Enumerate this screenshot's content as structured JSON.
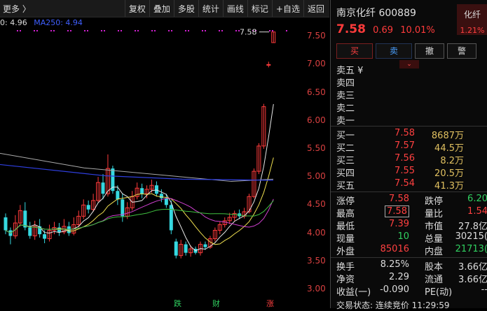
{
  "toolbar": {
    "more": "更多 〉",
    "tabs": [
      "复权",
      "叠加",
      "多股",
      "统计",
      "画线",
      "标记",
      "+自选",
      "返回"
    ]
  },
  "ma_legend": {
    "a": "0: 4.96",
    "b": "MA250: 4.94"
  },
  "price_axis": {
    "ticks": [
      "7.50",
      "7.00",
      "6.50",
      "6.00",
      "5.50",
      "5.00",
      "4.50",
      "4.00",
      "3.50",
      "3.00"
    ],
    "high_marker": "7.58"
  },
  "chart_markers": [
    "跌",
    "财",
    "涨"
  ],
  "chart_data": {
    "type": "candlestick",
    "ylim": [
      2.8,
      7.85
    ],
    "candles": [
      {
        "o": 4.28,
        "c": 4.05,
        "h": 4.35,
        "l": 3.98
      },
      {
        "o": 4.05,
        "c": 3.95,
        "h": 4.1,
        "l": 3.8
      },
      {
        "o": 3.95,
        "c": 4.18,
        "h": 4.32,
        "l": 3.9
      },
      {
        "o": 4.18,
        "c": 4.4,
        "h": 4.5,
        "l": 4.12
      },
      {
        "o": 4.4,
        "c": 4.1,
        "h": 4.55,
        "l": 4.05
      },
      {
        "o": 4.1,
        "c": 3.95,
        "h": 4.2,
        "l": 3.9
      },
      {
        "o": 3.95,
        "c": 4.12,
        "h": 4.22,
        "l": 3.88
      },
      {
        "o": 4.12,
        "c": 3.98,
        "h": 4.25,
        "l": 3.92
      },
      {
        "o": 3.98,
        "c": 3.9,
        "h": 4.05,
        "l": 3.82
      },
      {
        "o": 3.9,
        "c": 4.05,
        "h": 4.15,
        "l": 3.85
      },
      {
        "o": 4.05,
        "c": 4.1,
        "h": 4.2,
        "l": 3.98
      },
      {
        "o": 4.1,
        "c": 4.02,
        "h": 4.18,
        "l": 3.95
      },
      {
        "o": 4.02,
        "c": 4.12,
        "h": 4.25,
        "l": 3.98
      },
      {
        "o": 4.12,
        "c": 4.0,
        "h": 4.2,
        "l": 3.95
      },
      {
        "o": 4.0,
        "c": 4.15,
        "h": 4.28,
        "l": 3.96
      },
      {
        "o": 4.15,
        "c": 4.3,
        "h": 4.4,
        "l": 4.1
      },
      {
        "o": 4.3,
        "c": 4.5,
        "h": 4.6,
        "l": 4.25
      },
      {
        "o": 4.5,
        "c": 4.42,
        "h": 4.58,
        "l": 4.35
      },
      {
        "o": 4.42,
        "c": 4.58,
        "h": 4.7,
        "l": 4.38
      },
      {
        "o": 4.58,
        "c": 4.9,
        "h": 5.0,
        "l": 4.55
      },
      {
        "o": 4.9,
        "c": 4.7,
        "h": 5.05,
        "l": 4.6
      },
      {
        "o": 4.7,
        "c": 5.15,
        "h": 5.4,
        "l": 4.65
      },
      {
        "o": 5.15,
        "c": 4.75,
        "h": 5.2,
        "l": 4.7
      },
      {
        "o": 4.75,
        "c": 4.6,
        "h": 4.85,
        "l": 4.5
      },
      {
        "o": 4.6,
        "c": 4.3,
        "h": 4.7,
        "l": 4.2
      },
      {
        "o": 4.3,
        "c": 4.45,
        "h": 4.55,
        "l": 4.25
      },
      {
        "o": 4.45,
        "c": 4.65,
        "h": 4.75,
        "l": 4.4
      },
      {
        "o": 4.65,
        "c": 4.8,
        "h": 4.9,
        "l": 4.6
      },
      {
        "o": 4.8,
        "c": 4.7,
        "h": 4.88,
        "l": 4.62
      },
      {
        "o": 4.7,
        "c": 4.78,
        "h": 4.85,
        "l": 4.62
      },
      {
        "o": 4.78,
        "c": 4.85,
        "h": 4.95,
        "l": 4.72
      },
      {
        "o": 4.85,
        "c": 4.7,
        "h": 4.92,
        "l": 4.65
      },
      {
        "o": 4.7,
        "c": 4.62,
        "h": 4.78,
        "l": 4.55
      },
      {
        "o": 4.62,
        "c": 4.5,
        "h": 4.7,
        "l": 4.45
      },
      {
        "o": 4.5,
        "c": 4.05,
        "h": 4.58,
        "l": 3.98
      },
      {
        "o": 3.85,
        "c": 3.6,
        "h": 3.9,
        "l": 3.55
      },
      {
        "o": 3.6,
        "c": 3.8,
        "h": 3.88,
        "l": 3.55
      },
      {
        "o": 3.8,
        "c": 3.65,
        "h": 3.85,
        "l": 3.6
      },
      {
        "o": 3.65,
        "c": 3.72,
        "h": 3.78,
        "l": 3.58
      },
      {
        "o": 3.72,
        "c": 3.65,
        "h": 3.76,
        "l": 3.62
      },
      {
        "o": 3.65,
        "c": 3.8,
        "h": 3.85,
        "l": 3.6
      },
      {
        "o": 3.8,
        "c": 3.75,
        "h": 3.85,
        "l": 3.7
      },
      {
        "o": 3.75,
        "c": 3.9,
        "h": 3.95,
        "l": 3.72
      },
      {
        "o": 3.9,
        "c": 4.05,
        "h": 4.1,
        "l": 3.85
      },
      {
        "o": 4.05,
        "c": 4.15,
        "h": 4.2,
        "l": 3.98
      },
      {
        "o": 4.15,
        "c": 4.22,
        "h": 4.28,
        "l": 4.1
      },
      {
        "o": 4.22,
        "c": 4.28,
        "h": 4.36,
        "l": 4.16
      },
      {
        "o": 4.28,
        "c": 4.35,
        "h": 4.4,
        "l": 4.22
      },
      {
        "o": 4.35,
        "c": 4.3,
        "h": 4.42,
        "l": 4.25
      },
      {
        "o": 4.3,
        "c": 4.38,
        "h": 4.45,
        "l": 4.26
      },
      {
        "o": 4.38,
        "c": 4.65,
        "h": 4.7,
        "l": 4.35
      },
      {
        "o": 4.65,
        "c": 5.1,
        "h": 5.15,
        "l": 4.62
      },
      {
        "o": 5.1,
        "c": 5.55,
        "h": 5.6,
        "l": 5.05
      },
      {
        "o": 5.55,
        "c": 6.25,
        "h": 6.3,
        "l": 5.5
      },
      {
        "o": 7.0,
        "c": 7.0,
        "h": 7.05,
        "l": 6.95
      },
      {
        "o": 7.39,
        "c": 7.58,
        "h": 7.58,
        "l": 7.39
      }
    ]
  },
  "stock": {
    "title": "南京化纤 600889",
    "price": "7.58",
    "change": "0.69",
    "pct": "10.01%"
  },
  "badge": {
    "name": "化纤",
    "pct": "1.21%"
  },
  "trade_buttons": [
    "买",
    "卖",
    "撤",
    "警"
  ],
  "sell_book": [
    {
      "label": "卖五 ¥"
    },
    {
      "label": "卖四"
    },
    {
      "label": "卖三"
    },
    {
      "label": "卖二"
    },
    {
      "label": "卖一"
    }
  ],
  "buy_book": [
    {
      "label": "买一",
      "price": "7.58",
      "vol": "8687万"
    },
    {
      "label": "买二",
      "price": "7.57",
      "vol": "44.5万"
    },
    {
      "label": "买三",
      "price": "7.56",
      "vol": "8.2万"
    },
    {
      "label": "买四",
      "price": "7.55",
      "vol": "20.5万"
    },
    {
      "label": "买五",
      "price": "7.54",
      "vol": "41.3万"
    }
  ],
  "stats": [
    {
      "k1": "涨停",
      "v1": "7.58",
      "k2": "跌停",
      "v2": "6.20"
    },
    {
      "k1": "最高",
      "v1": "7.58",
      "k2": "量比",
      "v2": "1.54"
    },
    {
      "k1": "最低",
      "v1": "7.39",
      "k2": "市值",
      "v2": "27.8亿"
    },
    {
      "k1": "现量",
      "v1": "10",
      "k2": "总量",
      "v2": "30215("
    },
    {
      "k1": "外盘",
      "v1": "85016",
      "k2": "内盘",
      "v2": "21713("
    }
  ],
  "stats2": [
    {
      "k1": "换手",
      "v1": "8.25%",
      "k2": "股本",
      "v2": "3.66亿"
    },
    {
      "k1": "净资",
      "v1": "2.29",
      "k2": "流通",
      "v2": "3.66亿"
    },
    {
      "k1": "收益(一)",
      "v1": "-0.090",
      "k2": "PE(动)",
      "v2": "--"
    }
  ],
  "footer": "交易状态: 连续竞价 11:29:59"
}
